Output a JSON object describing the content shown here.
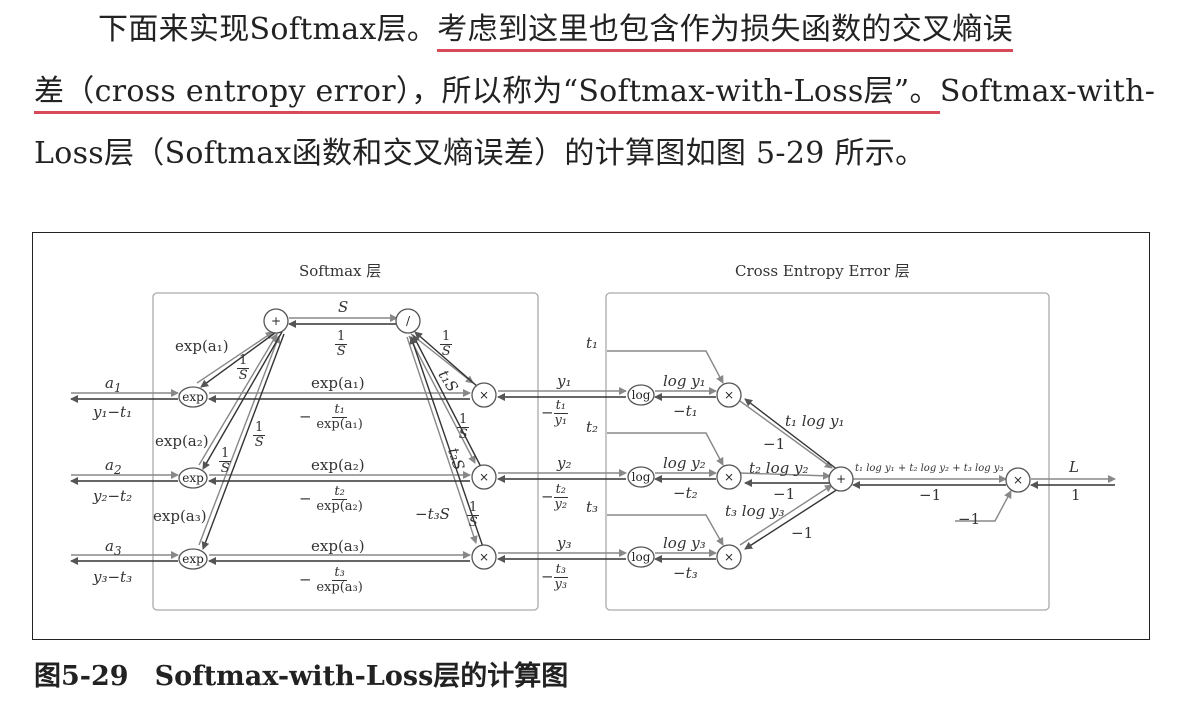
{
  "paragraph": {
    "line1_plain": "下面来实现Softmax层。",
    "line1_underlined": "考虑到这里也包含作为损失函数的交叉熵误",
    "line2_underlined": "差（cross entropy error），所以称为“Softmax-with-Loss层”。",
    "line2_plain": "Softmax-with-",
    "line3": "Loss层（Softmax函数和交叉熵误差）的计算图如图 5-29 所示。"
  },
  "caption": {
    "number": "图5-29",
    "title": "Softmax-with-Loss层的计算图"
  },
  "figure": {
    "softmax_box_title": "Softmax 层",
    "ce_box_title": "Cross Entropy Error 层",
    "nodes": {
      "plus": "+",
      "div": "/",
      "mul": "×",
      "exp": "exp",
      "log": "log"
    },
    "inputs": [
      {
        "a": "a",
        "sub": "1",
        "grad": "y₁−t₁"
      },
      {
        "a": "a",
        "sub": "2",
        "grad": "y₂−t₂"
      },
      {
        "a": "a",
        "sub": "3",
        "grad": "y₃−t₃"
      }
    ],
    "exp_labels": [
      "exp(a₁)",
      "exp(a₂)",
      "exp(a₃)"
    ],
    "neg_t": [
      "t₁",
      "t₂",
      "t₃"
    ],
    "neg_den": [
      "exp(a₁)",
      "exp(a₂)",
      "exp(a₃)"
    ],
    "S": "S",
    "one": "1",
    "minus": "−",
    "t1S": "t₁S",
    "t2S": "t₂S",
    "t3S": "−t₃S",
    "y": [
      "y₁",
      "y₂",
      "y₃"
    ],
    "t": [
      "t₁",
      "t₂",
      "t₃"
    ],
    "ty": [
      {
        "n": "t₁",
        "d": "y₁"
      },
      {
        "n": "t₂",
        "d": "y₂"
      },
      {
        "n": "t₃",
        "d": "y₃"
      }
    ],
    "logy": [
      "log y₁",
      "log y₂",
      "log y₃"
    ],
    "neg_t_grad": [
      "−t₁",
      "−t₂",
      "−t₃"
    ],
    "tlogy": [
      "t₁ log y₁",
      "t₂ log y₂",
      "t₃ log y₃"
    ],
    "minus_one": "−1",
    "sum_label": "t₁ log y₁ + t₂ log y₂ + t₃ log y₃",
    "L": "L",
    "final_grad": "1",
    "const": "−1"
  }
}
